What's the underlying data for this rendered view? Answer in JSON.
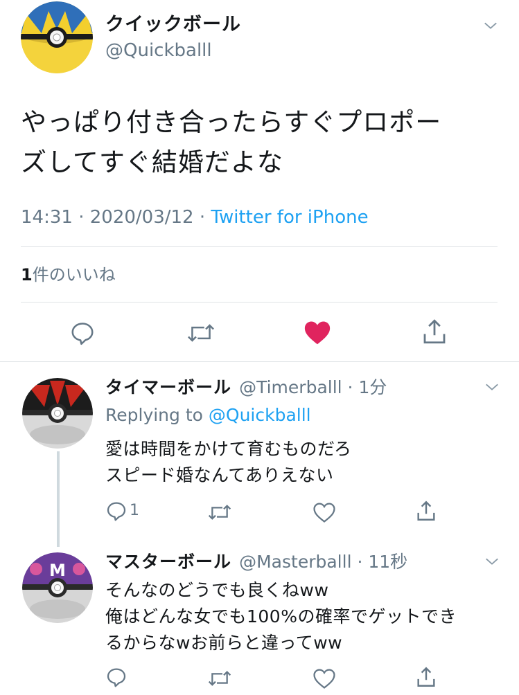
{
  "main_tweet": {
    "display_name": "クイックボール",
    "handle": "@Quickballl",
    "text_line1": "やっぱり付き合ったらすぐプロポー",
    "text_line2": "ズしてすぐ結婚だよな",
    "time": "14:31",
    "sep1": " · ",
    "date": "2020/03/12",
    "sep2": " · ",
    "source": "Twitter for iPhone",
    "like_count": "1",
    "like_label": "件のいいね",
    "liked": true,
    "colors": {
      "accent": "#1da1f2",
      "like": "#e0245e",
      "muted": "#657786"
    }
  },
  "replies": [
    {
      "display_name": "タイマーボール",
      "handle": "@Timerballl",
      "sep": " · ",
      "time_ago": "1分",
      "replying_prefix": "Replying to ",
      "replying_to": "@Quickballl",
      "text_line1": "愛は時間をかけて育むものだろ",
      "text_line2": "スピード婚なんてありえない",
      "reply_count": "1"
    },
    {
      "display_name": "マスターボール",
      "handle": "@Masterballl",
      "sep": " · ",
      "time_ago": "11秒",
      "text_line1": "そんなのどうでも良くねww",
      "text_line2": "俺はどんな女でも100%の確率でゲットでき",
      "text_line3": "るからなwお前らと違ってww",
      "avatar_letter": "M"
    }
  ],
  "icons": {
    "reply": "reply-icon",
    "retweet": "retweet-icon",
    "like": "heart-icon",
    "share": "share-icon",
    "more": "chevron-down-icon"
  }
}
